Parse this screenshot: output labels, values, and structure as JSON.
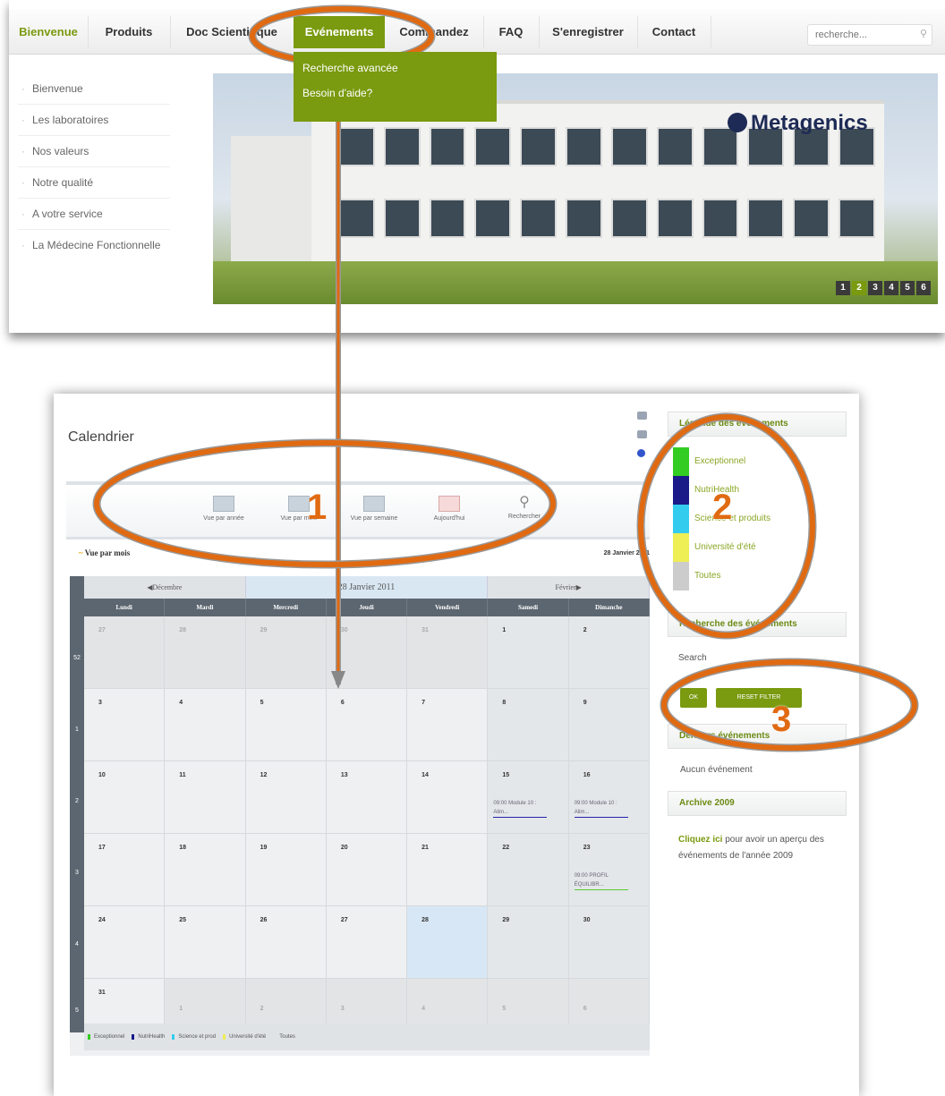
{
  "nav": {
    "items": [
      "Bienvenue",
      "Produits",
      "Doc Scientifique",
      "Evénements",
      "Commandez",
      "FAQ",
      "S'enregistrer",
      "Contact"
    ],
    "search_placeholder": "recherche...",
    "dropdown": [
      "Recherche avancée",
      "Besoin d'aide?"
    ]
  },
  "side_menu": [
    "Bienvenue",
    "Les laboratoires",
    "Nos valeurs",
    "Notre qualité",
    "A votre service",
    "La Médecine Fonctionnelle"
  ],
  "banner": {
    "brand": "Metagenics",
    "pages": [
      "1",
      "2",
      "3",
      "4",
      "5",
      "6"
    ]
  },
  "calendar": {
    "title": "Calendrier",
    "tools": [
      "Vue par année",
      "Vue par mois",
      "Vue par semaine",
      "Aujourd'hui",
      "Rechercher"
    ],
    "view_label": "Vue par mois",
    "current_date": "28 Janvier 2011",
    "nav": {
      "prev": "Décembre",
      "current": "28 Janvier 2011",
      "next": "Février"
    },
    "weekdays": [
      "Lundi",
      "Mardi",
      "Mercredi",
      "Jeudi",
      "Vendredi",
      "Samedi",
      "Dimanche"
    ],
    "weeks": [
      "52",
      "1",
      "2",
      "3",
      "4",
      "5"
    ],
    "days": [
      [
        "27",
        "28",
        "29",
        "30",
        "31",
        "1",
        "2"
      ],
      [
        "3",
        "4",
        "5",
        "6",
        "7",
        "8",
        "9"
      ],
      [
        "10",
        "11",
        "12",
        "13",
        "14",
        "15",
        "16"
      ],
      [
        "17",
        "18",
        "19",
        "20",
        "21",
        "22",
        "23"
      ],
      [
        "24",
        "25",
        "26",
        "27",
        "28",
        "29",
        "30"
      ],
      [
        "31",
        "1",
        "2",
        "3",
        "4",
        "5",
        "6"
      ]
    ],
    "events": {
      "sat15": "09:00 Module 10 : Alim...",
      "sun16": "09:00 Module 10 : Alim...",
      "sun23": "09:00 PROFIL ÉQUILIBR..."
    },
    "bottom_legend": [
      "Exceptionnel",
      "NutriHealth",
      "Science et prod",
      "Université d'été",
      "Toutes"
    ]
  },
  "sidebar": {
    "legend_title": "Légende des événements",
    "legend": [
      {
        "label": "Exceptionnel",
        "color": "#33cc22"
      },
      {
        "label": "NutriHealth",
        "color": "#1a1a88"
      },
      {
        "label": "Science et produits",
        "color": "#33ccee"
      },
      {
        "label": "Université d'été",
        "color": "#eeee55"
      },
      {
        "label": "Toutes",
        "color": "#cccccc"
      }
    ],
    "search_title": "Recherche des événements",
    "search_label": "Search",
    "ok_label": "OK",
    "reset_label": "RESET FILTER",
    "upcoming_title": "Derniers événements",
    "no_events": "Aucun événement",
    "archive_title": "Archive 2009",
    "archive_link": "Cliquez ici",
    "archive_text": " pour avoir un aperçu des événements de l'année 2009"
  },
  "callouts": [
    "1",
    "2",
    "3"
  ],
  "colors": {
    "accent": "#7a9a0f",
    "annotation": "#e06a12"
  }
}
